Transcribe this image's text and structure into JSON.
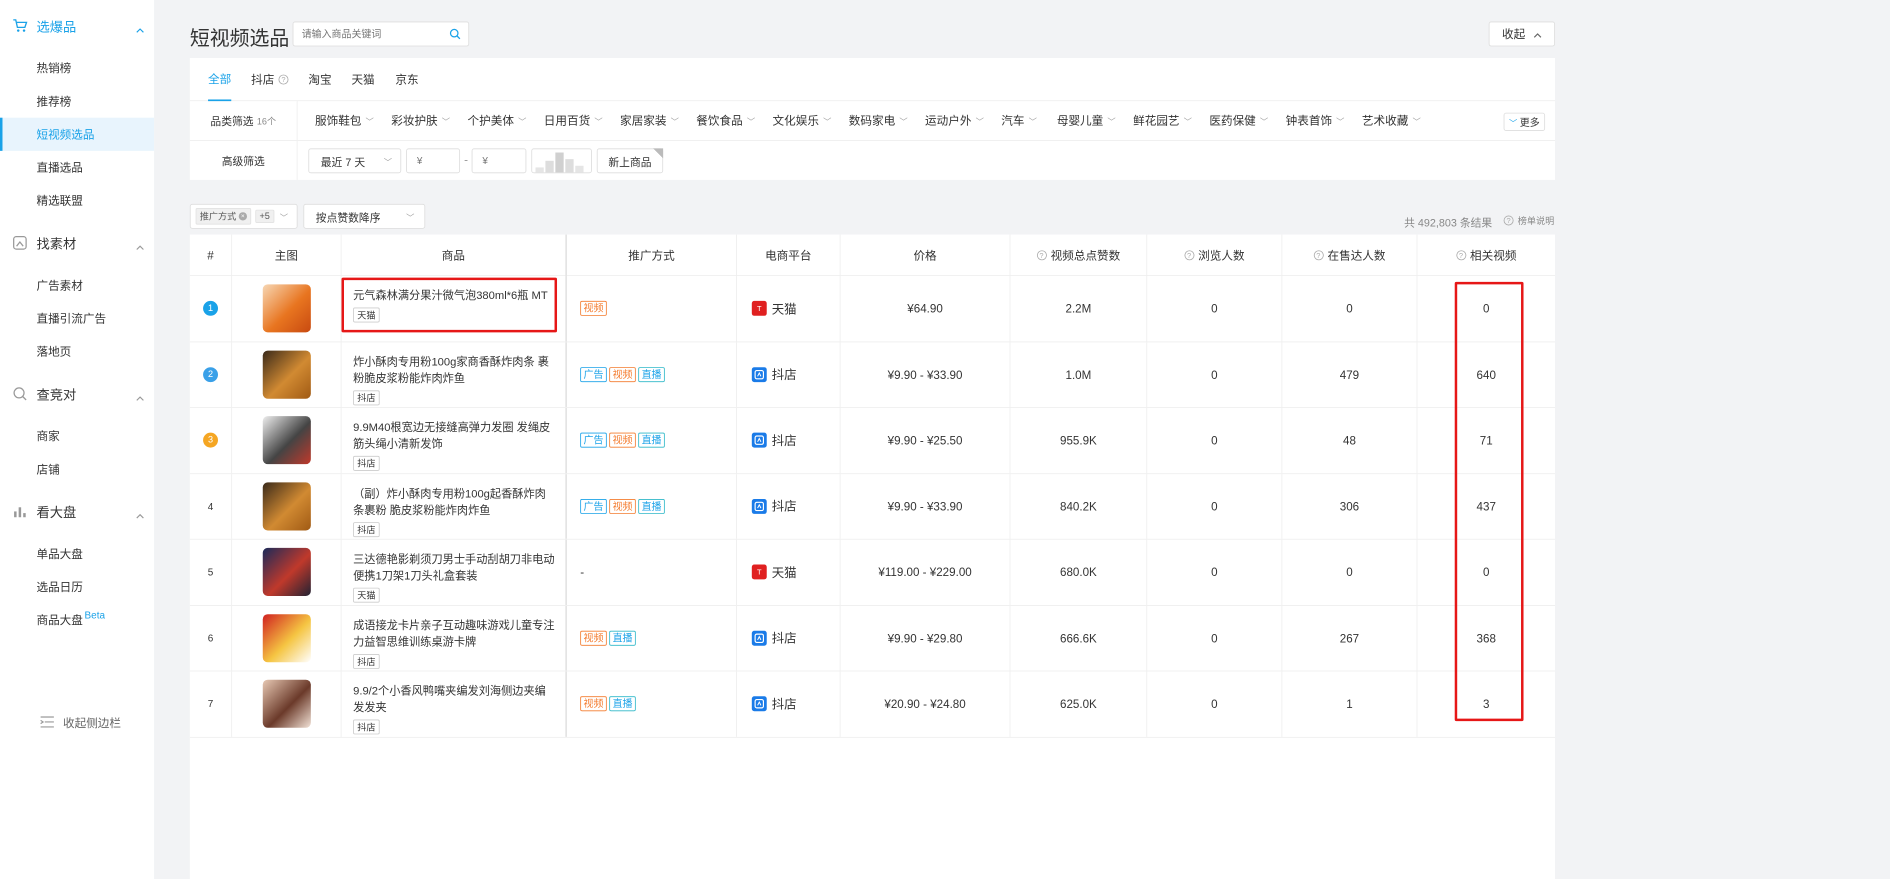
{
  "sidebar": {
    "groups": [
      {
        "label": "选爆品",
        "icon": "cart-icon",
        "items": [
          "热销榜",
          "推荐榜",
          "短视频选品",
          "直播选品",
          "精选联盟"
        ]
      },
      {
        "label": "找素材",
        "icon": "material-icon",
        "items": [
          "广告素材",
          "直播引流广告",
          "落地页"
        ]
      },
      {
        "label": "查竞对",
        "icon": "competitor-icon",
        "items": [
          "商家",
          "店铺"
        ]
      },
      {
        "label": "看大盘",
        "icon": "chart-icon",
        "items": [
          "单品大盘",
          "选品日历",
          "商品大盘"
        ]
      }
    ],
    "beta": "Beta",
    "collapse_label": "收起侧边栏"
  },
  "header": {
    "title": "短视频选品",
    "search_placeholder": "请输入商品关键词",
    "collapse_button": "收起"
  },
  "tabs": [
    "全部",
    "抖店",
    "淘宝",
    "天猫",
    "京东"
  ],
  "filters": {
    "category_label": "品类筛选",
    "category_count": "16个",
    "categories": [
      "服饰鞋包",
      "彩妆护肤",
      "个护美体",
      "日用百货",
      "家居家装",
      "餐饮食品",
      "文化娱乐",
      "数码家电",
      "运动户外",
      "汽车",
      "母婴儿童",
      "鲜花园艺",
      "医药保健",
      "钟表首饰",
      "艺术收藏"
    ],
    "more": "更多",
    "advanced_label": "高级筛选",
    "date_select": "最近 7 天",
    "price_min_placeholder": "¥",
    "price_max_placeholder": "¥",
    "price_sep": "-",
    "new_product": "新上商品"
  },
  "toolbar": {
    "promo_filter": "推广方式",
    "promo_count": "+5",
    "sort": "按点赞数降序",
    "total": "共 492,803 条结果",
    "rank_note": "榜单说明"
  },
  "columns": [
    "#",
    "主图",
    "商品",
    "推广方式",
    "电商平台",
    "价格",
    "视频总点赞数",
    "浏览人数",
    "在售达人数",
    "相关视频"
  ],
  "rows": [
    {
      "rank": "1",
      "title": "元气森林满分果汁微气泡380ml*6瓶 MT",
      "plat_tag": "天猫",
      "promo": [
        "视频"
      ],
      "platform": "天猫",
      "price": "¥64.90",
      "likes": "2.2M",
      "views": "0",
      "sellers": "0",
      "videos": "0"
    },
    {
      "rank": "2",
      "title": "炸小酥肉专用粉100g家商香酥炸肉条 裹粉脆皮浆粉能炸肉炸鱼",
      "plat_tag": "抖店",
      "promo": [
        "广告",
        "视频",
        "直播"
      ],
      "platform": "抖店",
      "price": "¥9.90 - ¥33.90",
      "likes": "1.0M",
      "views": "0",
      "sellers": "479",
      "videos": "640"
    },
    {
      "rank": "3",
      "title": "9.9M40根宽边无接缝高弹力发圈 发绳皮筋头绳小清新发饰",
      "plat_tag": "抖店",
      "promo": [
        "广告",
        "视频",
        "直播"
      ],
      "platform": "抖店",
      "price": "¥9.90 - ¥25.50",
      "likes": "955.9K",
      "views": "0",
      "sellers": "48",
      "videos": "71"
    },
    {
      "rank": "4",
      "title": "（副）炸小酥肉专用粉100g起香酥炸肉条裹粉 脆皮浆粉能炸肉炸鱼",
      "plat_tag": "抖店",
      "promo": [
        "广告",
        "视频",
        "直播"
      ],
      "platform": "抖店",
      "price": "¥9.90 - ¥33.90",
      "likes": "840.2K",
      "views": "0",
      "sellers": "306",
      "videos": "437"
    },
    {
      "rank": "5",
      "title": "三达德艳影剃须刀男士手动刮胡刀非电动便携1刀架1刀头礼盒套装",
      "plat_tag": "天猫",
      "promo": [],
      "promo_empty": "-",
      "platform": "天猫",
      "price": "¥119.00 - ¥229.00",
      "likes": "680.0K",
      "views": "0",
      "sellers": "0",
      "videos": "0"
    },
    {
      "rank": "6",
      "title": "成语接龙卡片亲子互动趣味游戏儿童专注力益智思维训练桌游卡牌",
      "plat_tag": "抖店",
      "promo": [
        "视频",
        "直播"
      ],
      "platform": "抖店",
      "price": "¥9.90 - ¥29.80",
      "likes": "666.6K",
      "views": "0",
      "sellers": "267",
      "videos": "368"
    },
    {
      "rank": "7",
      "title": "9.9/2个小香风鸭嘴夹编发刘海侧边夹编发发夹",
      "plat_tag": "抖店",
      "promo": [
        "视频",
        "直播"
      ],
      "platform": "抖店",
      "price": "¥20.90 - ¥24.80",
      "likes": "625.0K",
      "views": "0",
      "sellers": "1",
      "videos": "3"
    }
  ],
  "colors": {
    "accent": "#1aa2e8",
    "highlight": "#e61717",
    "video_tag": "#f47c2f"
  }
}
